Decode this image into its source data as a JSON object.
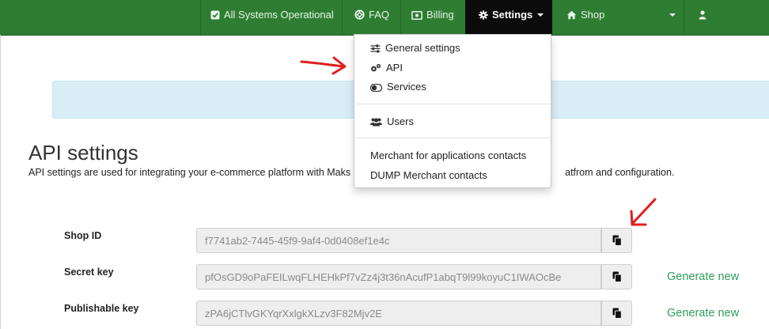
{
  "navbar": {
    "status_label": "All Systems Operational",
    "faq_label": "FAQ",
    "billing_label": "Billing",
    "settings_label": "Settings",
    "shop_label": "Shop"
  },
  "settings_menu": {
    "items": [
      {
        "label": "General settings",
        "icon": "sliders-icon"
      },
      {
        "label": "API",
        "icon": "gears-icon"
      },
      {
        "label": "Services",
        "icon": "toggle-icon"
      },
      {
        "label": "Users",
        "icon": "users-icon"
      },
      {
        "label": "Merchant for applications contacts"
      },
      {
        "label": "DUMP Merchant contacts"
      }
    ]
  },
  "page": {
    "title": "API settings",
    "description_start": "API settings are used for integrating your e-commerce platform with Maks",
    "description_end": "atfrom and configuration."
  },
  "fields": [
    {
      "label": "Shop ID",
      "value": "f7741ab2-7445-45f9-9af4-0d0408ef1e4c",
      "action": ""
    },
    {
      "label": "Secret key",
      "value": "pfOsGD9oPaFEILwqFLHEHkPf7vZz4j3t36nAcufP1abqT9l99koyuC1IWAOcBe",
      "action": "Generate new"
    },
    {
      "label": "Publishable key",
      "value": "zPA6jCTlvGKYqrXxlgkXLzv3F82Mjv2E",
      "action": "Generate new"
    }
  ],
  "colors": {
    "navbar": "#2e7d32",
    "active_tab": "#0b0b0b",
    "link": "#2e9e5b",
    "annotation_arrow": "#e01e1e",
    "alert_bg": "#d9edf7"
  }
}
